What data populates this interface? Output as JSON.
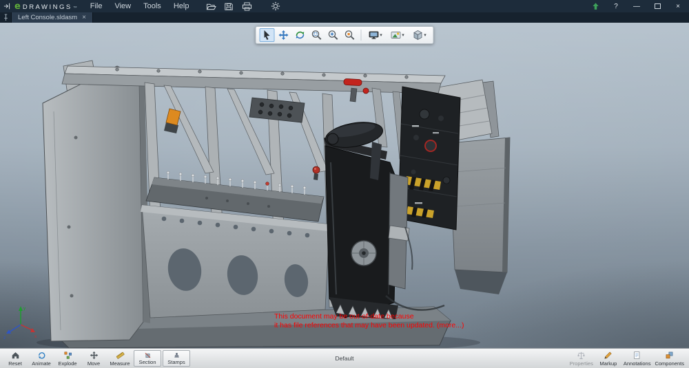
{
  "colors": {
    "titlebar_bg": "#1d2c3b",
    "logo_green": "#5fae3a",
    "warning_text": "#ff0000",
    "active_tool_bg": "#d2e4f6"
  },
  "titlebar": {
    "logo": {
      "e": "e",
      "text": "DRAWINGS",
      "tm": "™"
    },
    "menus": [
      "File",
      "View",
      "Tools",
      "Help"
    ],
    "help": "?",
    "window": {
      "minimize": "—",
      "close": "×"
    }
  },
  "tabbar": {
    "tab": "Left Console.sldasm",
    "close": "×"
  },
  "icons": {
    "dropdown": "▾"
  },
  "viewport": {
    "warning": {
      "line1": "This document may be out-of-date because",
      "line2": "it has file references that may have been updated.",
      "more": "(more...)"
    },
    "triad": {
      "x": "x",
      "y": "y",
      "z": "z"
    }
  },
  "statusbar": {
    "config": "Default",
    "left": [
      {
        "name": "reset",
        "label": "Reset"
      },
      {
        "name": "animate",
        "label": "Animate"
      },
      {
        "name": "explode",
        "label": "Explode"
      },
      {
        "name": "move",
        "label": "Move"
      },
      {
        "name": "measure",
        "label": "Measure"
      },
      {
        "name": "section",
        "label": "Section"
      },
      {
        "name": "stamps",
        "label": "Stamps"
      }
    ],
    "right": [
      {
        "name": "properties",
        "label": "Properties",
        "disabled": true
      },
      {
        "name": "markup",
        "label": "Markup"
      },
      {
        "name": "annotations",
        "label": "Annotations"
      },
      {
        "name": "components",
        "label": "Components"
      }
    ]
  }
}
